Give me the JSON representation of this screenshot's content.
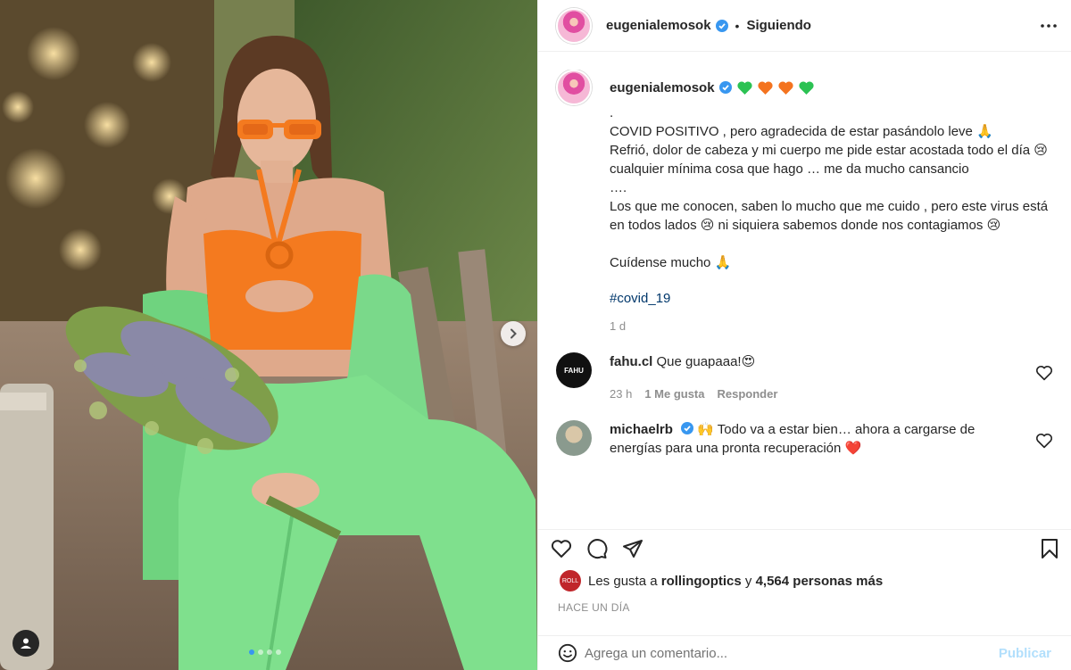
{
  "post": {
    "username": "eugenialemosok",
    "separator": "•",
    "follow_status": "Siguiendo",
    "caption": {
      "username": "eugenialemosok",
      "emoji_hearts": [
        "green-heart",
        "orange-heart",
        "orange-heart",
        "green-heart"
      ],
      "text": ".\nCOVID POSITIVO , pero agradecida de estar pasándolo leve 🙏\nRefrió, dolor de cabeza y mi cuerpo me pide estar acostada todo el día 😢 cualquier mínima cosa que hago … me da mucho cansancio\n….\nLos que me conocen, saben lo mucho que me cuido , pero este virus está en todos lados 😢 ni siquiera sabemos donde nos contagiamos 😢\n\nCuídense mucho 🙏",
      "hashtag": "#covid_19",
      "time": "1 d"
    },
    "comments": [
      {
        "username": "fahu.cl",
        "text": "Que guapaaa!😍",
        "time": "23 h",
        "likes": "1 Me gusta",
        "reply": "Responder",
        "avatar_text": "FAHU"
      },
      {
        "username": "michaelrb",
        "verified": true,
        "text": "🙌 Todo va a estar bien… ahora a cargarse de energías para una pronta recuperación ❤️"
      }
    ],
    "likes": {
      "prefix": "Les gusta a",
      "user": "rollingoptics",
      "conj": "y",
      "count": "4,564 personas más",
      "avatar_text": "ROLL"
    },
    "posted_ago": "HACE UN DÍA",
    "add_comment": {
      "placeholder": "Agrega un comentario...",
      "publish": "Publicar"
    }
  },
  "colors": {
    "verified": "#3897f0",
    "link": "#00376b",
    "publish_disabled": "#b2dffc",
    "secondary_text": "#8e8e8e",
    "green_heart": "#2bc253",
    "orange_heart": "#f4731f",
    "carousel_active_dot": "#3897f0"
  },
  "media": {
    "carousel_total": 4,
    "carousel_active": 1
  }
}
